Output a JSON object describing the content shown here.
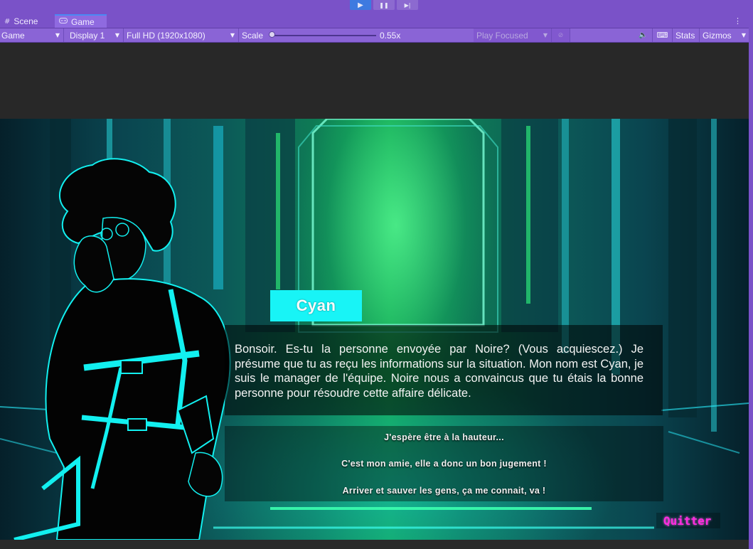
{
  "playbar": {
    "play_icon": "▶",
    "pause_icon": "❚❚",
    "step_icon": "▶|"
  },
  "tabs": [
    {
      "label": "Scene",
      "icon": "grid-icon"
    },
    {
      "label": "Game",
      "icon": "gamepad-icon"
    }
  ],
  "tab_menu_icon": "⋮",
  "toolbar": {
    "game_mode": "Game",
    "display": "Display 1",
    "resolution": "Full HD (1920x1080)",
    "scale_label": "Scale",
    "scale_value": "0.55x",
    "play_focused": "Play Focused",
    "stats": "Stats",
    "gizmos": "Gizmos"
  },
  "game": {
    "speaker_name": "Cyan",
    "dialogue": "Bonsoir. Es-tu la personne envoyée par Noire? (Vous acquiescez.) Je présume que tu as reçu les informations sur la situation. Mon nom est Cyan, je suis le manager de l'équipe. Noire nous a convaincus que tu étais la bonne personne pour résoudre cette affaire délicate.",
    "choices": [
      "J'espère être à la hauteur...",
      "C'est mon amie, elle a donc un bon jugement !",
      "Arriver et sauver les gens, ça me connait, va !"
    ],
    "quit_label": "Quitter"
  },
  "colors": {
    "editor_purple": "#7a52c8",
    "play_active": "#3e7ae0",
    "name_box": "#18f4f6",
    "quit_text": "#ff2be0"
  }
}
